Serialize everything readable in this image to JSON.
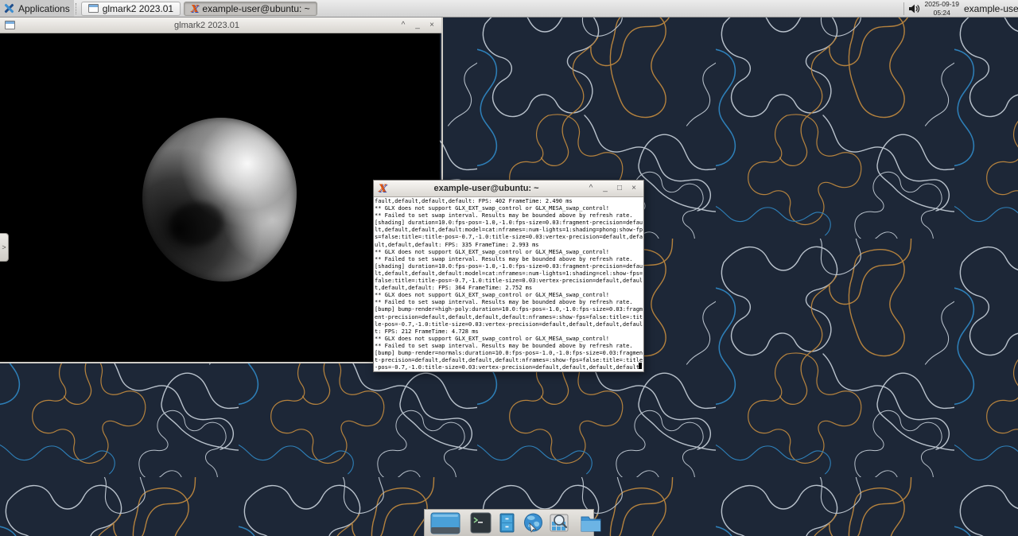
{
  "panel": {
    "applications": {
      "label": "Applications"
    },
    "tasks": [
      {
        "label": "glmark2 2023.01"
      },
      {
        "label": "example-user@ubuntu: ~"
      }
    ],
    "clock": {
      "date": "2025-09-19",
      "time": "05:24"
    },
    "user_label": "example-user"
  },
  "windows": {
    "glmark": {
      "title": "glmark2 2023.01",
      "controls": {
        "shade": "^",
        "minimize": "_",
        "close": "×"
      }
    },
    "terminal": {
      "title": "example-user@ubuntu: ~",
      "controls": {
        "shade": "^",
        "minimize": "_",
        "maximize": "□",
        "close": "×"
      },
      "lines": [
        "fault,default,default,default: FPS: 402 FrameTime: 2.490 ms",
        "** GLX does not support GLX_EXT_swap_control or GLX_MESA_swap_control!",
        "** Failed to set swap interval. Results may be bounded above by refresh rate.",
        "[shading] duration=10.0:fps-pos=-1.0,-1.0:fps-size=0.03:fragment-precision=defau",
        "lt,default,default,default:model=cat:nframes=:num-lights=1:shading=phong:show-fp",
        "s=false:title=:title-pos=-0.7,-1.0:title-size=0.03:vertex-precision=default,defa",
        "ult,default,default: FPS: 335 FrameTime: 2.993 ms",
        "** GLX does not support GLX_EXT_swap_control or GLX_MESA_swap_control!",
        "** Failed to set swap interval. Results may be bounded above by refresh rate.",
        "[shading] duration=10.0:fps-pos=-1.0,-1.0:fps-size=0.03:fragment-precision=defau",
        "lt,default,default,default:model=cat:nframes=:num-lights=1:shading=cel:show-fps=",
        "false:title=:title-pos=-0.7,-1.0:title-size=0.03:vertex-precision=default,defaul",
        "t,default,default: FPS: 364 FrameTime: 2.752 ms",
        "** GLX does not support GLX_EXT_swap_control or GLX_MESA_swap_control!",
        "** Failed to set swap interval. Results may be bounded above by refresh rate.",
        "[bump] bump-render=high-poly:duration=10.0:fps-pos=-1.0,-1.0:fps-size=0.03:fragm",
        "ent-precision=default,default,default,default:nframes=:show-fps=false:title=:tit",
        "le-pos=-0.7,-1.0:title-size=0.03:vertex-precision=default,default,default,defaul",
        "t: FPS: 212 FrameTime: 4.728 ms",
        "** GLX does not support GLX_EXT_swap_control or GLX_MESA_swap_control!",
        "** Failed to set swap interval. Results may be bounded above by refresh rate.",
        "[bump] bump-render=normals:duration=10.0:fps-pos=-1.0,-1.0:fps-size=0.03:fragmen",
        "t-precision=default,default,default,default:nframes=:show-fps=false:title=:title",
        "-pos=-0.7,-1.0:title-size=0.03:vertex-precision=default,default,default,default"
      ]
    }
  },
  "edge_handle": {
    "glyph": ">"
  },
  "icons": {
    "xterm_glyph": "X"
  },
  "dock": {
    "items": [
      "show-desktop",
      "terminal",
      "file-manager",
      "web-browser",
      "application-finder",
      "file-folder"
    ]
  },
  "colors": {
    "wallpaper_base": "#1d2737",
    "contour_light": "#b9c2cc",
    "contour_orange": "#b5823d",
    "contour_blue": "#2d7fb8",
    "panel_bg": "#dcdcdc",
    "titlebar_bg": "#e6e3de",
    "terminal_bg": "#ffffff",
    "terminal_fg": "#000000",
    "asteroid_gray": "#8f8f8f"
  }
}
